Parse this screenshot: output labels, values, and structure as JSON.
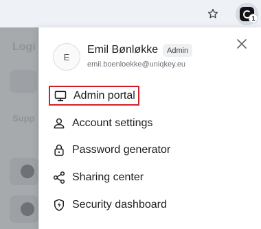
{
  "toolbar": {
    "extension_badge": "1"
  },
  "background": {
    "title_fragment": "Logi",
    "section_fragment": "Supp"
  },
  "popup": {
    "avatar_initial": "E",
    "user_name": "Emil Bønløkke",
    "role_badge": "Admin",
    "user_email": "emil.boenloekke@uniqkey.eu",
    "menu": [
      {
        "label": "Admin portal",
        "icon": "monitor-icon"
      },
      {
        "label": "Account settings",
        "icon": "user-icon"
      },
      {
        "label": "Password generator",
        "icon": "lock-icon"
      },
      {
        "label": "Sharing center",
        "icon": "share-icon"
      },
      {
        "label": "Security dashboard",
        "icon": "shield-bolt-icon"
      }
    ],
    "highlight_color": "#d21f26"
  }
}
